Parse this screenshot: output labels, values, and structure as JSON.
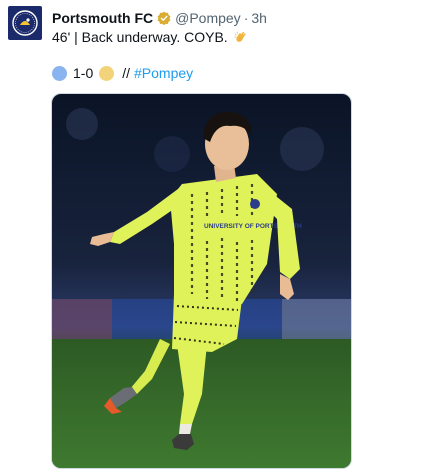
{
  "account": {
    "name": "Portsmouth FC",
    "handle": "@Pompey",
    "separator": "·",
    "time": "3h"
  },
  "tweet": {
    "text": "46' | Back underway. COYB.",
    "emoji_icon": "clap-hands-icon"
  },
  "score": {
    "value": "1-0",
    "separator": "//",
    "hashtag": "#Pompey",
    "home_color": "#8ab4f0",
    "away_color": "#f3d37a"
  },
  "media": {
    "kit_text": "UNIVERSITY OF PORTSMOUTH",
    "kit_color": "#dff25a"
  },
  "colors": {
    "link": "#1d9bf0",
    "secondary_text": "#536471",
    "verified_badge": "#d9ad31",
    "crest_background": "#1b2a6b"
  }
}
